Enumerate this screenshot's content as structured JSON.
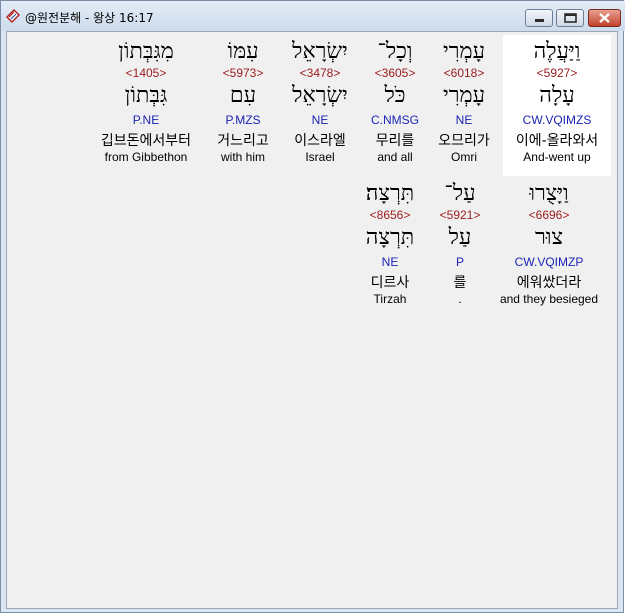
{
  "window": {
    "title": "@원전분해 - 왕상 16:17",
    "minimize_label": "minimize",
    "maximize_label": "maximize",
    "close_label": "close"
  },
  "verse_line1": [
    {
      "hebrew": "וַיַּעֲלֶה",
      "strong": "<5927>",
      "lemma": "עָלָה",
      "morph": "CW.VQIMZS",
      "korean": "이에-올라와서",
      "english": "And-went up"
    },
    {
      "hebrew": "עָמְרִי",
      "strong": "<6018>",
      "lemma": "עָמְרִי",
      "morph": "NE",
      "korean": "오므리가",
      "english": "Omri"
    },
    {
      "hebrew": "וְכָל־",
      "strong": "<3605>",
      "lemma": "כֹּל",
      "morph": "C.NMSG",
      "korean": "무리를",
      "english": "and all"
    },
    {
      "hebrew": "יִשְׂרָאֵל",
      "strong": "<3478>",
      "lemma": "יִשְׂרָאֵל",
      "morph": "NE",
      "korean": "이스라엘",
      "english": "Israel"
    },
    {
      "hebrew": "עִמּוֹ",
      "strong": "<5973>",
      "lemma": "עִם",
      "morph": "P.MZS",
      "korean": "거느리고",
      "english": "with him"
    },
    {
      "hebrew": "מִגִּבְּתוֹן",
      "strong": "<1405>",
      "lemma": "גִּבְּתוֹן",
      "morph": "P.NE",
      "korean": "깁브돈에서부터",
      "english": "from Gibbethon"
    }
  ],
  "verse_line2": [
    {
      "hebrew": "וַיָּצֻרוּ",
      "strong": "<6696>",
      "lemma": "צוּר",
      "morph": "CW.VQIMZP",
      "korean": "에워쌌더라",
      "english": "and they besieged"
    },
    {
      "hebrew": "עַל־",
      "strong": "<5921>",
      "lemma": "עַל",
      "morph": "P",
      "korean": "를",
      "english": "."
    },
    {
      "hebrew": "תִּרְצָה׃",
      "strong": "<8656>",
      "lemma": "תִּרְצָה",
      "morph": "NE",
      "korean": "디르사",
      "english": "Tirzah"
    }
  ]
}
